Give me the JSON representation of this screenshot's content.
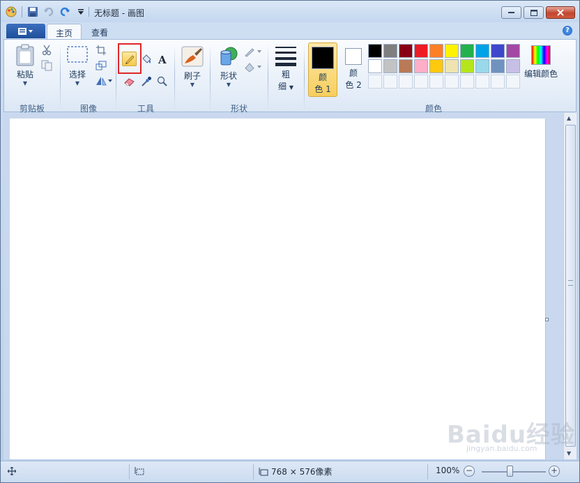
{
  "window": {
    "title": "无标题 - 画图"
  },
  "tabs": {
    "home": "主页",
    "view": "查看"
  },
  "groups": {
    "clipboard": {
      "label": "剪贴板",
      "paste": "粘贴"
    },
    "image": {
      "label": "图像",
      "select": "选择"
    },
    "tools": {
      "label": "工具"
    },
    "brushes": {
      "label": "刷子"
    },
    "shapes": {
      "label": "形状",
      "shapes_btn": "形状"
    },
    "size": {
      "label_line1": "粗",
      "label_line2": "细"
    },
    "colors": {
      "label": "颜色",
      "color1_line1": "颜",
      "color1_line2": "色 1",
      "color2_line1": "颜",
      "color2_line2": "色 2",
      "edit_colors": "编辑颜色",
      "color1_value": "#000000",
      "color2_value": "#ffffff",
      "palette": [
        "#000000",
        "#7f7f7f",
        "#880015",
        "#ed1c24",
        "#ff7f27",
        "#fff200",
        "#22b14c",
        "#00a2e8",
        "#3f48cc",
        "#a349a4",
        "#ffffff",
        "#c3c3c3",
        "#b97a57",
        "#ffaec9",
        "#ffc90e",
        "#efe4b0",
        "#b5e61d",
        "#99d9ea",
        "#7092be",
        "#c8bfe7",
        "",
        "",
        "",
        "",
        "",
        "",
        "",
        "",
        "",
        ""
      ]
    }
  },
  "status": {
    "dimensions": "768 × 576像素",
    "zoom": "100%"
  },
  "watermark": {
    "text": "Baidu经验",
    "sub": "jingyan.baidu.com"
  }
}
